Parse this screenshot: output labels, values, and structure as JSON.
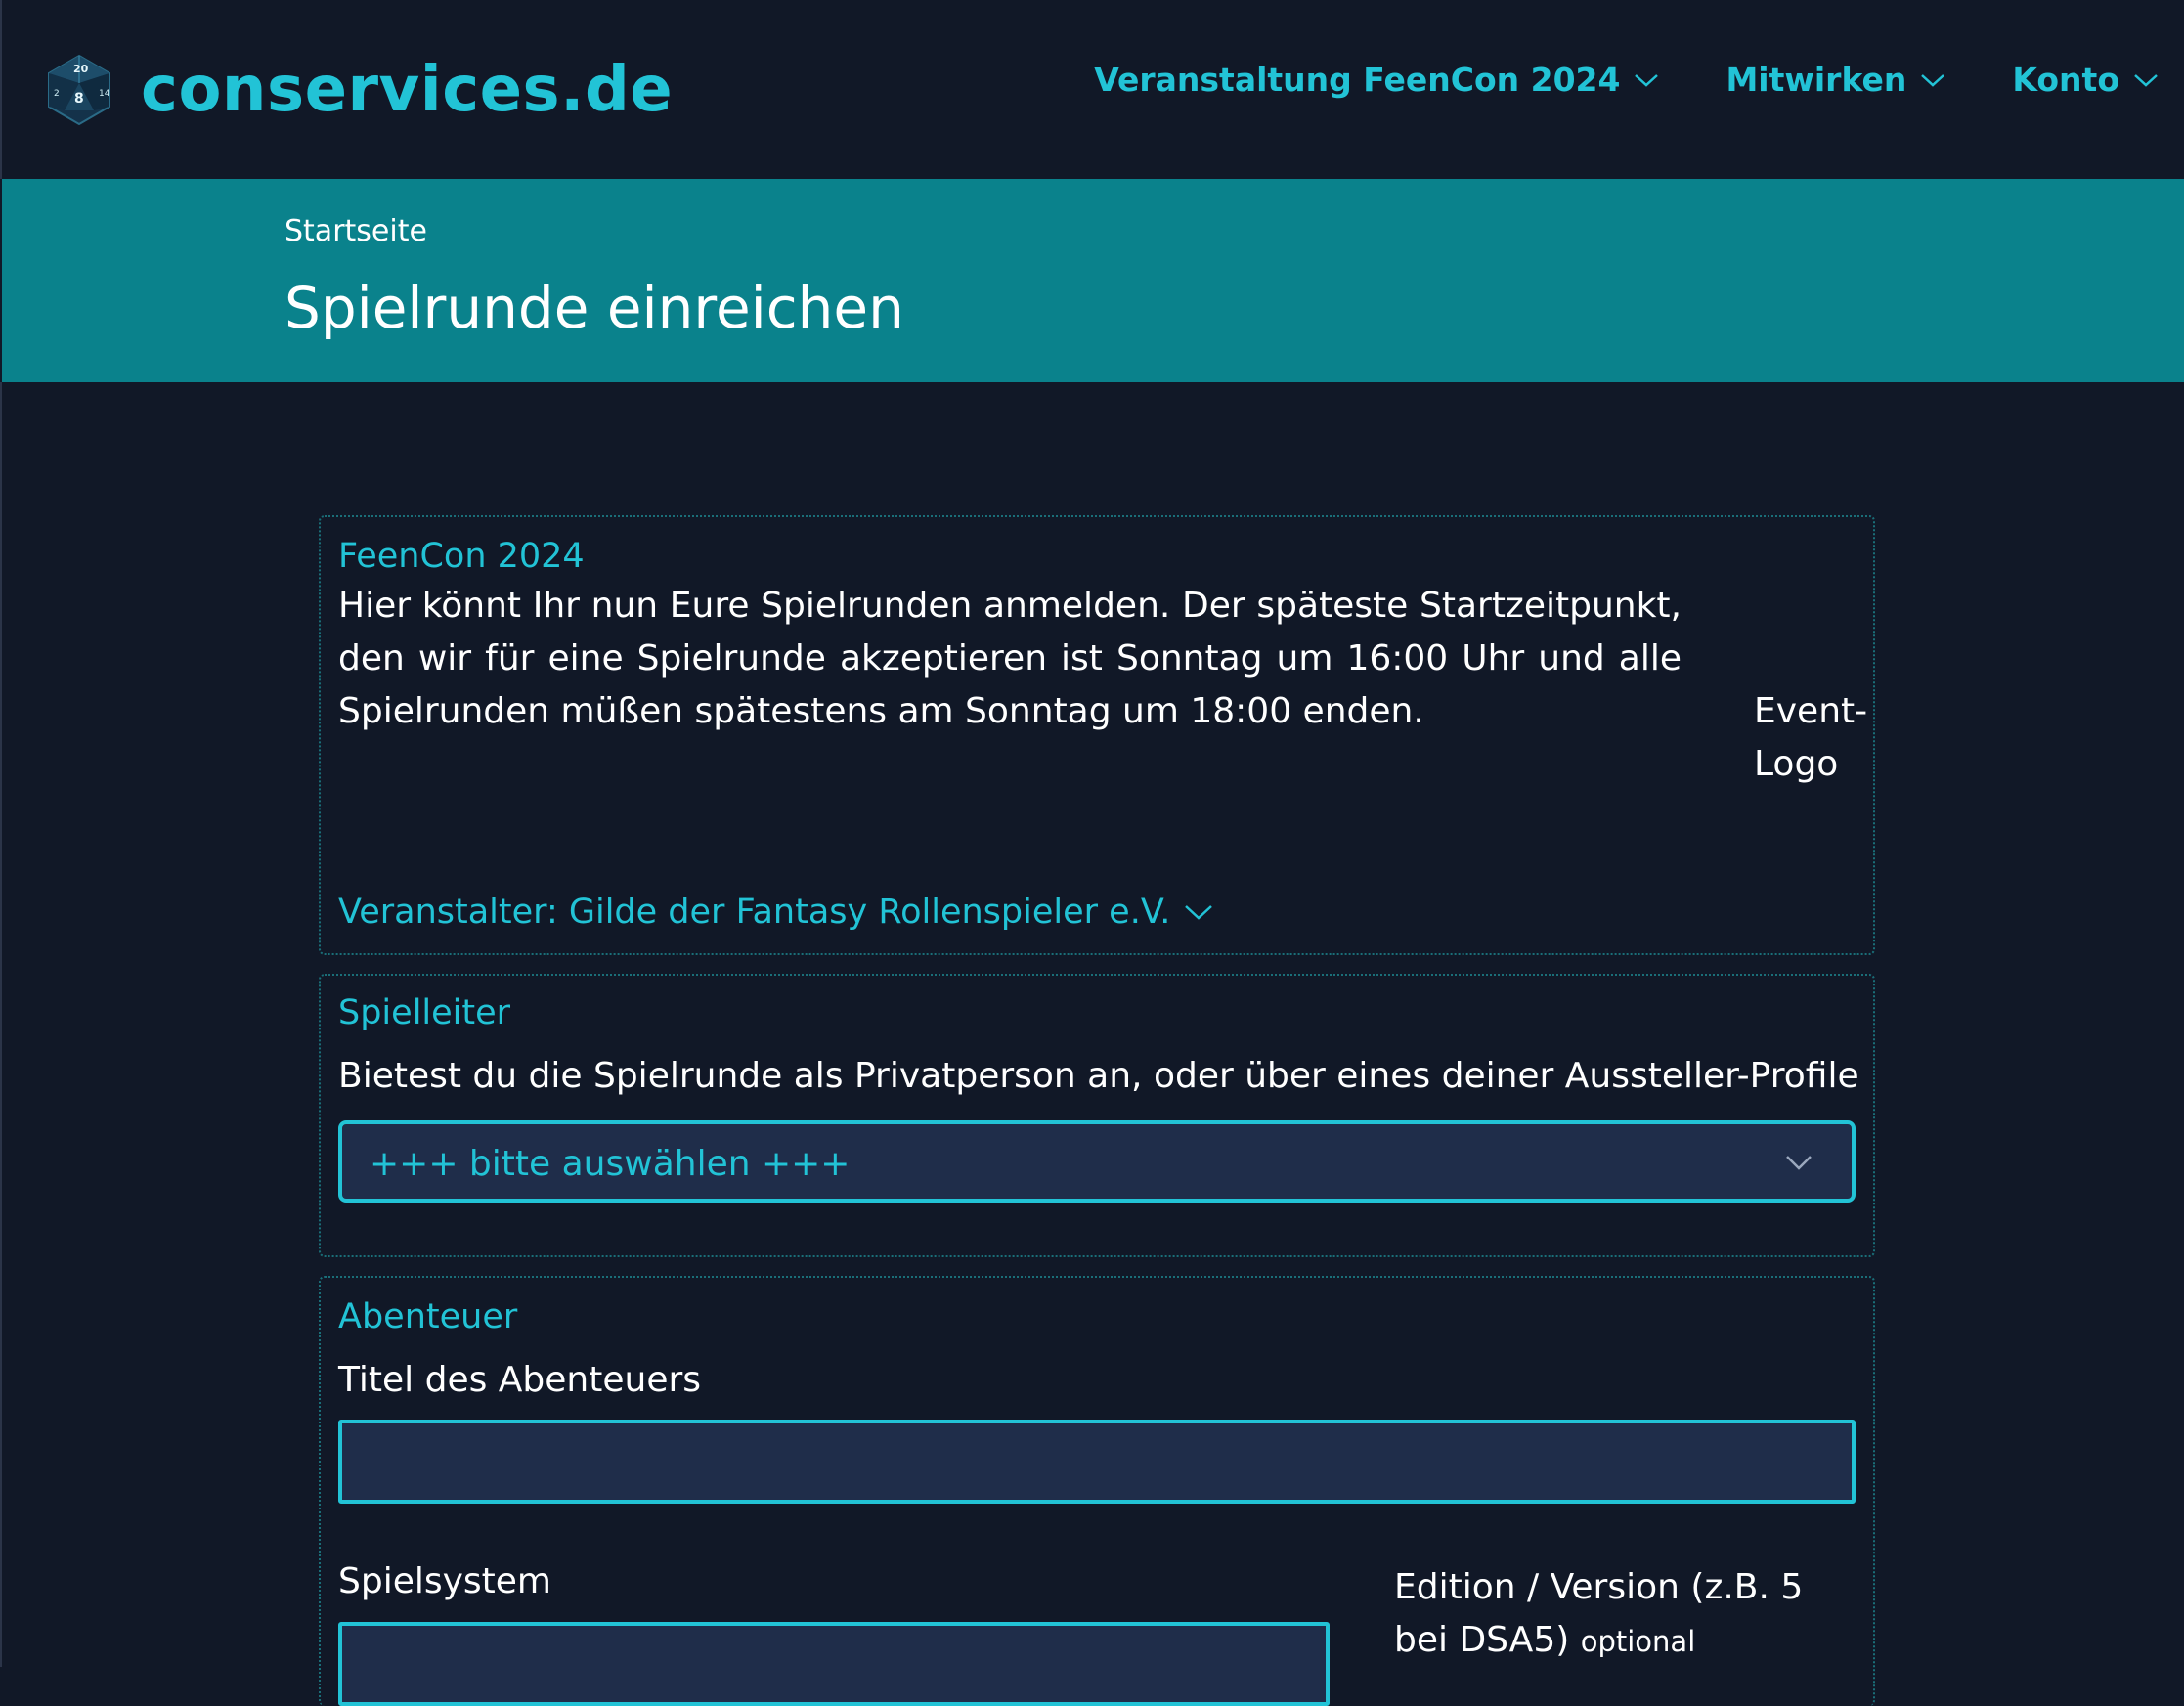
{
  "header": {
    "brand": "conservices.de",
    "logo_icon": "d20-dice-icon",
    "nav": [
      {
        "label": "Veranstaltung FeenCon 2024"
      },
      {
        "label": "Mitwirken"
      },
      {
        "label": "Konto"
      }
    ]
  },
  "hero": {
    "breadcrumb": "Startseite",
    "title": "Spielrunde einreichen"
  },
  "event": {
    "title": "FeenCon 2024",
    "text": "Hier könnt Ihr nun Eure Spielrunden anmelden. Der späteste Startzeitpunkt, den wir für eine Spielrunde akzeptieren ist Sonntag um 16:00 Uhr und alle Spielrunden müßen spätestens am Sonntag um 18:00 enden.",
    "logo_alt": "Event-Logo",
    "organizer": "Veranstalter: Gilde der Fantasy Rollenspieler e.V."
  },
  "gamemaster": {
    "title": "Spielleiter",
    "label": "Bietest du die Spielrunde als Privatperson an, oder über eines deiner Aussteller-Profile",
    "select_value": "+++ bitte auswählen +++"
  },
  "adventure": {
    "title": "Abenteuer",
    "title_label": "Titel des Abenteuers",
    "title_value": "",
    "system_label": "Spielsystem",
    "system_value": "",
    "edition_label": "Edition / Version (z.B. 5 bei DSA5)",
    "edition_optional": "optional"
  },
  "colors": {
    "background": "#111827",
    "accent": "#22c3d6",
    "hero": "#0a828c",
    "input_bg": "#1f2d4a"
  }
}
